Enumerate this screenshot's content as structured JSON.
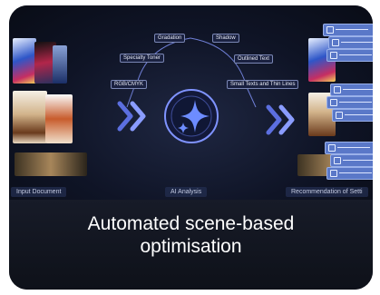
{
  "diagram": {
    "nodes": [
      "Gradation",
      "Shadow",
      "Specialty Toner",
      "Outlined Text",
      "RGB/CMYK",
      "Small Texts and Thin Lines"
    ],
    "stages": [
      "Input Document",
      "AI Analysis",
      "Recommendation of Setti"
    ],
    "center_icon": "sparkle-icon"
  },
  "caption": {
    "line1": "Automated scene-based",
    "line2": "optimisation"
  },
  "colors": {
    "background": "#0b0e18",
    "accent": "#6f7fd6",
    "caption_text": "#ffffff"
  }
}
